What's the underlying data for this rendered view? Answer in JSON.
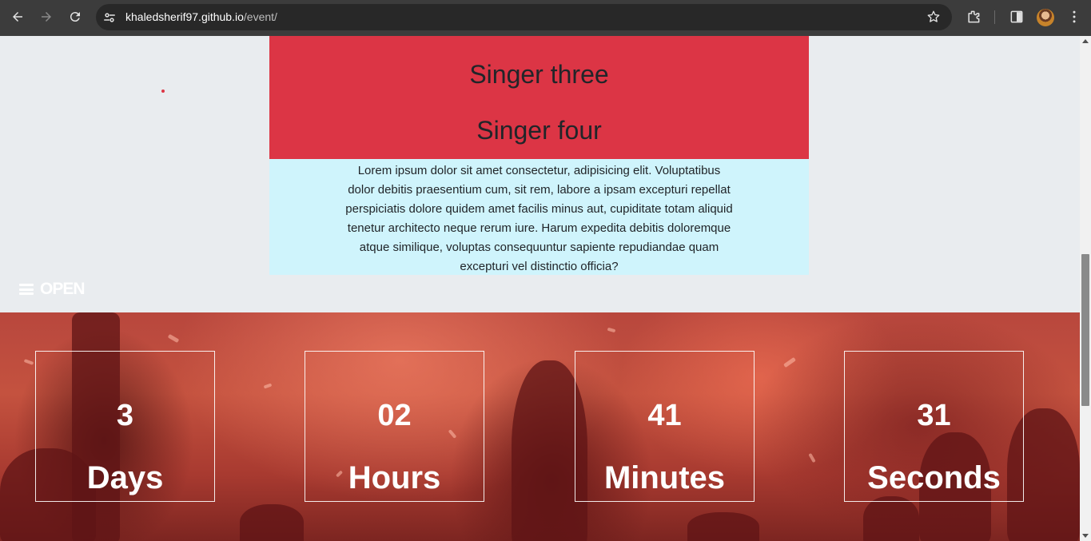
{
  "browser": {
    "url_host": "khaledsherif97.github.io",
    "url_path": "/event/",
    "icons": [
      "back-arrow-icon",
      "forward-arrow-icon",
      "reload-icon",
      "site-settings-icon",
      "bookmark-star-icon",
      "extensions-icon",
      "side-panel-icon",
      "profile-avatar",
      "menu-kebab-icon"
    ]
  },
  "singers": {
    "items": [
      "Singer three",
      "Singer four"
    ],
    "background": "#dc3545"
  },
  "about": {
    "text": "Lorem ipsum dolor sit amet consectetur, adipisicing elit. Voluptatibus dolor debitis praesentium cum, sit rem, labore a ipsam excepturi repellat perspiciatis dolore quidem amet facilis minus aut, cupiditate totam aliquid tenetur architecto neque rerum iure. Harum expedita debitis doloremque atque similique, voluptas consequuntur sapiente repudiandae quam excepturi vel distinctio officia?",
    "background": "#cff4fc"
  },
  "menu": {
    "open_label": "OPEN",
    "icon": "hamburger-menu-icon"
  },
  "countdown": {
    "items": [
      {
        "value": "3",
        "label": "Days"
      },
      {
        "value": "02",
        "label": "Hours"
      },
      {
        "value": "41",
        "label": "Minutes"
      },
      {
        "value": "31",
        "label": "Seconds"
      }
    ]
  }
}
